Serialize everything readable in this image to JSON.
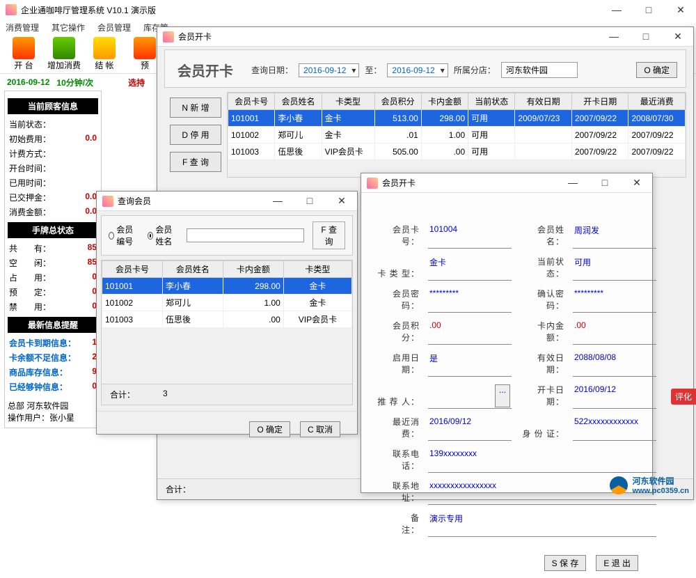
{
  "main_window": {
    "title": "企业通咖啡厅管理系统 V10.1  演示版",
    "menus": [
      "消费管理",
      "其它操作",
      "会员管理",
      "库存管"
    ],
    "toolbar": [
      "开 台",
      "增加消费",
      "结 帐",
      "预"
    ],
    "status_date": "2016-09-12",
    "status_interval": "10分钟/次",
    "select_label": "选持"
  },
  "left": {
    "sec1_title": "当前顾客信息",
    "rows1": [
      {
        "k": "当前状态：",
        "v": ""
      },
      {
        "k": "初始费用：",
        "v": "0.0"
      },
      {
        "k": "计费方式：",
        "v": ""
      },
      {
        "k": "开台时间：",
        "v": ""
      },
      {
        "k": "已用时间：",
        "v": ""
      },
      {
        "k": "已交押金：",
        "v": "0.0"
      },
      {
        "k": "消费金额：",
        "v": "0.0"
      }
    ],
    "sec2_title": "手牌总状态",
    "rows2_labels": [
      "共　　有：",
      "空　　闲：",
      "占　　用：",
      "预　　定：",
      "禁　　用："
    ],
    "rows2_vals": [
      "85",
      "85",
      "0",
      "0",
      "0"
    ],
    "sec3_title": "最新信息提醒",
    "rows3": [
      {
        "k": "会员卡到期信息：",
        "v": "1"
      },
      {
        "k": "卡余额不足信息：",
        "v": "2"
      },
      {
        "k": "商品库存信息：",
        "v": "9"
      },
      {
        "k": "已经够钟信息：",
        "v": "0"
      }
    ],
    "footer1": "总部  河东软件园",
    "footer2": "操作用户：张小星"
  },
  "card_window": {
    "title": "会员开卡",
    "heading": "会员开卡",
    "lbl_query_date": "查询日期：",
    "date_from": "2016-09-12",
    "lbl_to": "至：",
    "date_to": "2016-09-12",
    "lbl_branch": "所属分店：",
    "branch": "河东软件园",
    "btn_ok": "O 确定",
    "side_buttons": [
      "N 新 增",
      "D 停 用",
      "F 查 询"
    ],
    "cols": [
      "会员卡号",
      "会员姓名",
      "卡类型",
      "会员积分",
      "卡内金额",
      "当前状态",
      "有效日期",
      "开卡日期",
      "最近消费"
    ],
    "rows": [
      {
        "no": "101001",
        "name": "李小春",
        "type": "金卡",
        "pts": "513.00",
        "bal": "298.00",
        "st": "可用",
        "valid": "2009/07/23",
        "open": "2007/09/22",
        "last": "2008/07/30",
        "sel": true
      },
      {
        "no": "101002",
        "name": "郑可儿",
        "type": "金卡",
        "pts": ".01",
        "bal": "1.00",
        "st": "可用",
        "valid": "",
        "open": "2007/09/22",
        "last": "2007/09/22"
      },
      {
        "no": "101003",
        "name": "伍思後",
        "type": "VIP会员卡",
        "pts": "505.00",
        "bal": ".00",
        "st": "可用",
        "valid": "",
        "open": "2007/09/22",
        "last": "2007/09/22"
      }
    ],
    "total_label": "合计：",
    "eval_text": "评化"
  },
  "search_window": {
    "title": "查询会员",
    "radio_no": "会员编号",
    "radio_name": "会员姓名",
    "btn_find": "F 查询",
    "cols": [
      "会员卡号",
      "会员姓名",
      "卡内金额",
      "卡类型"
    ],
    "rows": [
      {
        "no": "101001",
        "name": "李小春",
        "bal": "298.00",
        "type": "金卡",
        "sel": true
      },
      {
        "no": "101002",
        "name": "郑可儿",
        "bal": "1.00",
        "type": "金卡"
      },
      {
        "no": "101003",
        "name": "伍思後",
        "bal": ".00",
        "type": "VIP会员卡"
      }
    ],
    "total_label": "合计：",
    "total_val": "3",
    "btn_ok": "O 确定",
    "btn_cancel": "C 取消"
  },
  "form_window": {
    "title": "会员开卡",
    "fields": {
      "card_no_l": "会员卡号：",
      "card_no": "101004",
      "name_l": "会员姓名：",
      "name": "周润发",
      "type_l": "卡 类 型：",
      "type": "金卡",
      "status_l": "当前状态：",
      "status": "可用",
      "pwd_l": "会员密码：",
      "pwd": "*********",
      "pwd2_l": "确认密码：",
      "pwd2": "*********",
      "pts_l": "会员积分：",
      "pts": ".00",
      "bal_l": "卡内金额：",
      "bal": ".00",
      "enable_l": "启用日期：",
      "enable": "是",
      "valid_l": "有效日期：",
      "valid": "2088/08/08",
      "ref_l": "推 荐 人：",
      "ref": "",
      "open_l": "开卡日期：",
      "open": "2016/09/12",
      "last_l": "最近消费：",
      "last": "2016/09/12",
      "id_l": "身 份 证：",
      "id": "522xxxxxxxxxxxx",
      "phone_l": "联系电话：",
      "phone": "139xxxxxxxx",
      "addr_l": "联系地址：",
      "addr": "xxxxxxxxxxxxxxxx",
      "note_l": "备　　注：",
      "note": "演示专用"
    },
    "btn_save": "S 保 存",
    "btn_exit": "E 退 出"
  },
  "watermark": {
    "text": "河东软件园",
    "url": "www.pc0359.cn"
  }
}
